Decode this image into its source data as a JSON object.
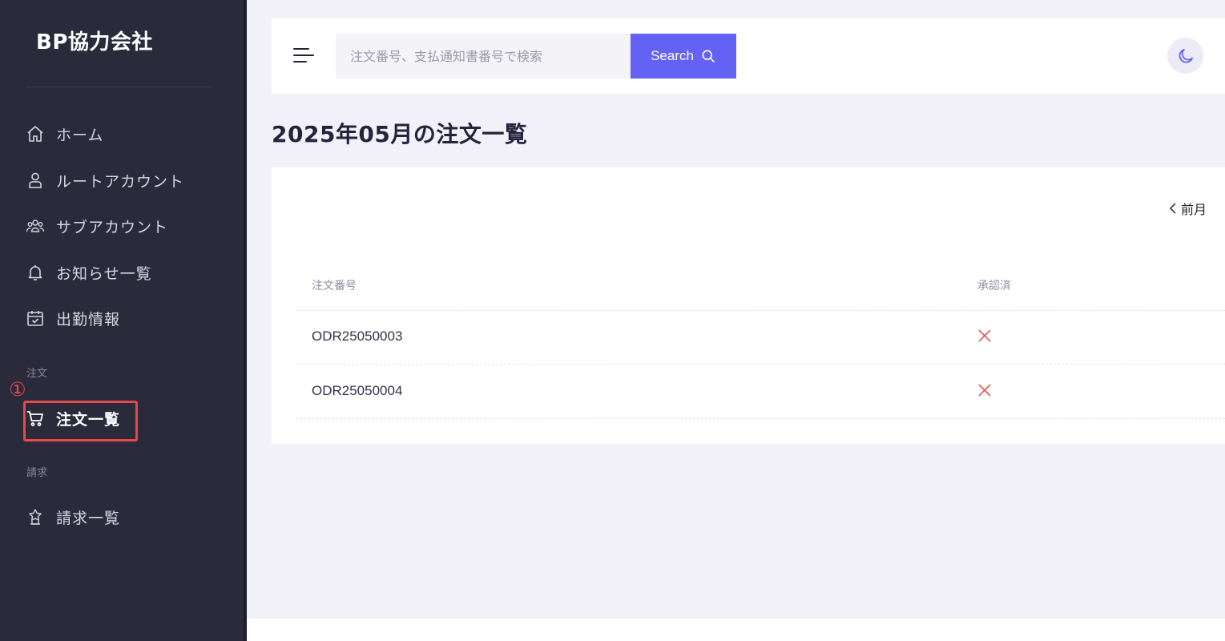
{
  "sidebar": {
    "brand": "BP協力会社",
    "items": [
      {
        "label": "ホーム",
        "icon": "home-icon"
      },
      {
        "label": "ルートアカウント",
        "icon": "user-icon"
      },
      {
        "label": "サブアカウント",
        "icon": "users-icon"
      },
      {
        "label": "お知らせ一覧",
        "icon": "bell-icon"
      },
      {
        "label": "出勤情報",
        "icon": "calendar-check-icon"
      }
    ],
    "section_order": "注文",
    "order_item": {
      "label": "注文一覧",
      "icon": "cart-icon"
    },
    "section_billing": "請求",
    "billing_item": {
      "label": "請求一覧",
      "icon": "award-icon"
    }
  },
  "annotation": {
    "number": "①",
    "color": "#e5484d"
  },
  "header": {
    "search_placeholder": "注文番号、支払通知書番号で検索",
    "search_button_label": "Search",
    "accent_color": "#6461f5"
  },
  "page": {
    "title": "2025年05月の注文一覧",
    "prev_month_label": "前月"
  },
  "table": {
    "columns": [
      "注文番号",
      "承認済"
    ],
    "rows": [
      {
        "order_no": "ODR25050003",
        "approved": false
      },
      {
        "order_no": "ODR25050004",
        "approved": false
      }
    ]
  }
}
